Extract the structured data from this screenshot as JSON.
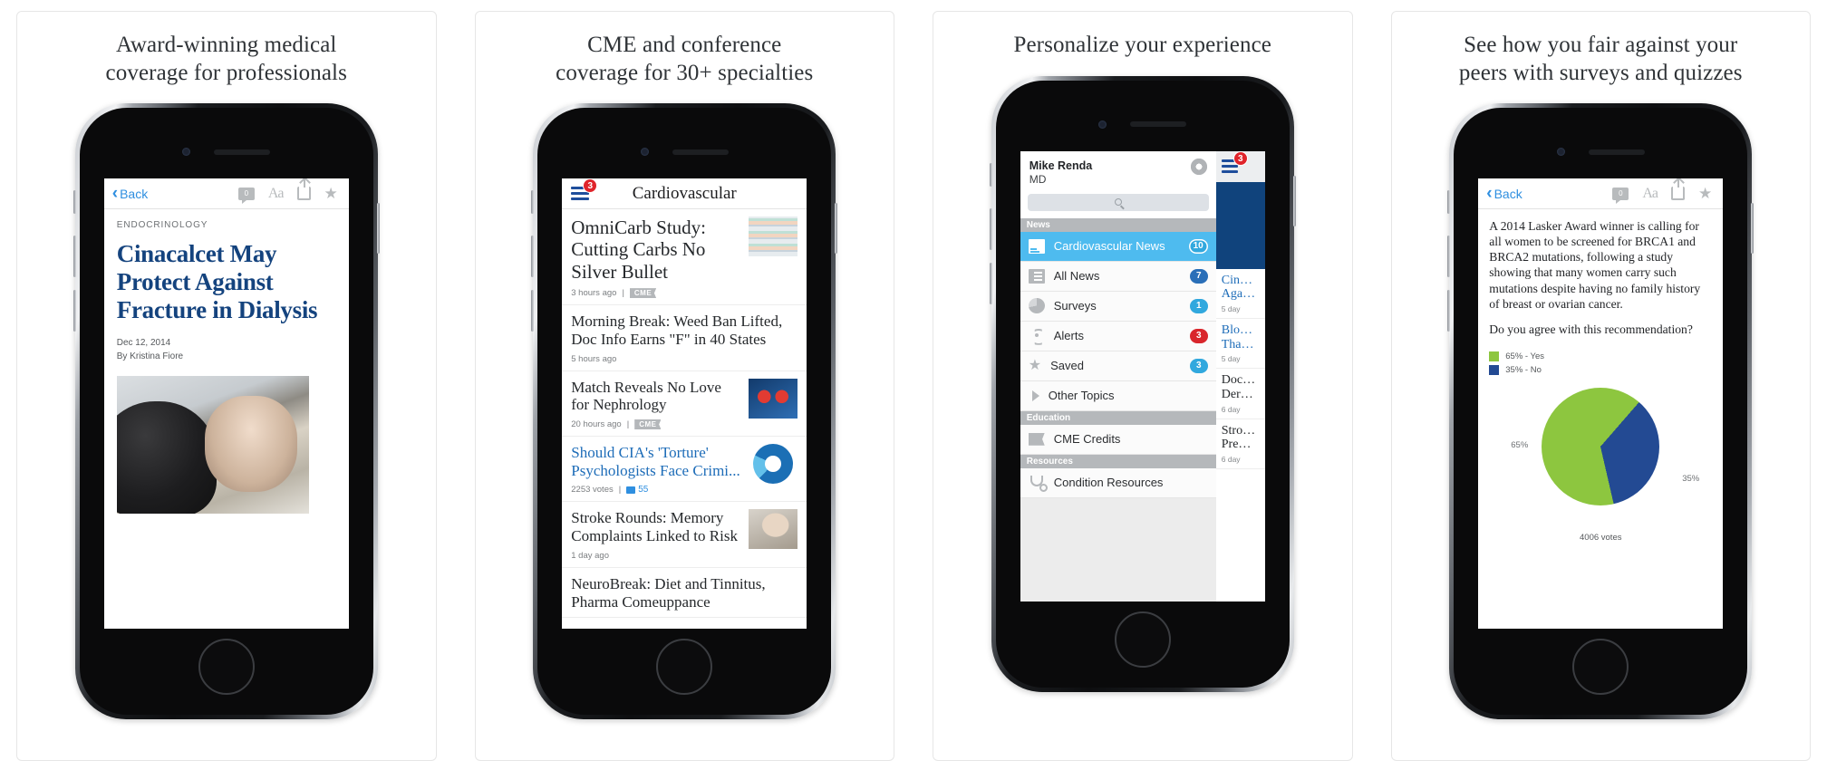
{
  "panels": [
    {
      "caption": "Award-winning medical\ncoverage for professionals",
      "type": "article",
      "toolbar": {
        "back_label": "Back",
        "comment_count": "0",
        "font_icon": "Aa"
      },
      "article": {
        "kicker": "ENDOCRINOLOGY",
        "headline": "Cinacalcet May Protect Against Fracture in Dialysis",
        "date": "Dec 12, 2014",
        "byline": "By Kristina Fiore"
      }
    },
    {
      "caption": "CME and conference\ncoverage for 30+ specialties",
      "type": "list",
      "header": {
        "title": "Cardiovascular",
        "menu_badge": "3"
      },
      "articles": [
        {
          "title": "OmniCarb Study: Cutting Carbs No Silver Bullet",
          "time": "3 hours ago",
          "tag": "CME",
          "thumb": "pills",
          "lead": true,
          "blue": false
        },
        {
          "title": "Morning Break: Weed Ban Lifted, Doc Info Earns \"F\" in 40 States",
          "time": "5 hours ago",
          "tag": "",
          "thumb": "",
          "lead": false,
          "blue": false
        },
        {
          "title": "Match Reveals No Love for Nephrology",
          "time": "20 hours ago",
          "tag": "CME",
          "thumb": "kidney",
          "lead": false,
          "blue": false
        },
        {
          "title": "Should CIA's 'Torture' Psychologists Face Crimi...",
          "time": "2253 votes",
          "tag": "",
          "comments": "55",
          "thumb": "donut",
          "lead": false,
          "blue": true
        },
        {
          "title": "Stroke Rounds: Memory Complaints Linked to Risk",
          "time": "1 day ago",
          "tag": "",
          "thumb": "man",
          "lead": false,
          "blue": false
        },
        {
          "title": "NeuroBreak: Diet and Tinnitus, Pharma Comeuppance",
          "time": "",
          "tag": "",
          "thumb": "",
          "lead": false,
          "blue": false
        }
      ]
    },
    {
      "caption": "Personalize your experience",
      "type": "menu",
      "user": {
        "name": "Mike Renda",
        "degree": "MD"
      },
      "search_placeholder": "",
      "sections": [
        {
          "label": "News",
          "items": [
            {
              "label": "Cardiovascular News",
              "badge": "10",
              "badge_style": "b-white",
              "icon": "news-icon",
              "active": true
            },
            {
              "label": "All News",
              "badge": "7",
              "badge_style": "b-blue",
              "icon": "list-icon",
              "active": false
            },
            {
              "label": "Surveys",
              "badge": "1",
              "badge_style": "b-lblue",
              "icon": "pie-icon",
              "active": false
            },
            {
              "label": "Alerts",
              "badge": "3",
              "badge_style": "b-red",
              "icon": "alert-icon",
              "active": false
            },
            {
              "label": "Saved",
              "badge": "3",
              "badge_style": "b-lblue",
              "icon": "star-icon",
              "active": false
            },
            {
              "label": "Other Topics",
              "badge": "",
              "badge_style": "",
              "icon": "triangle-icon",
              "active": false
            }
          ]
        },
        {
          "label": "Education",
          "items": [
            {
              "label": "CME Credits",
              "badge": "",
              "badge_style": "",
              "icon": "cme-icon",
              "active": false
            }
          ]
        },
        {
          "label": "Resources",
          "items": [
            {
              "label": "Condition Resources",
              "badge": "",
              "badge_style": "",
              "icon": "stethoscope-icon",
              "active": false
            }
          ]
        }
      ],
      "peek": {
        "badge": "3",
        "items": [
          {
            "title": "Cin… Aga…",
            "sub": "5 day",
            "blue": true
          },
          {
            "title": "Blo… Tha…",
            "sub": "5 day",
            "blue": true
          },
          {
            "title": "Doc… Der…",
            "sub": "6 day",
            "blue": false
          },
          {
            "title": "Stro… Pre…",
            "sub": "6 day",
            "blue": false
          }
        ]
      }
    },
    {
      "caption": "See how you fair against your\npeers with surveys and quizzes",
      "type": "survey",
      "toolbar": {
        "back_label": "Back",
        "comment_count": "0",
        "font_icon": "Aa"
      },
      "survey": {
        "body": "A 2014 Lasker Award winner is calling for all women to be screened for BRCA1 and BRCA2 mutations, following a study showing that many women carry such mutations despite having no family history of breast or ovarian cancer.",
        "question": "Do you agree with this recommendation?",
        "votes": "4006 votes"
      },
      "chart_data": {
        "type": "pie",
        "title": "Do you agree with this recommendation?",
        "categories": [
          "Yes",
          "No"
        ],
        "values": [
          65,
          35
        ],
        "labels": [
          "65%",
          "35%"
        ],
        "legend": [
          "65% - Yes",
          "35% - No"
        ],
        "legend_position": "top-left",
        "colors": [
          "#8dc63f",
          "#234a93"
        ],
        "total_votes": 4006,
        "units": "percent"
      }
    }
  ]
}
